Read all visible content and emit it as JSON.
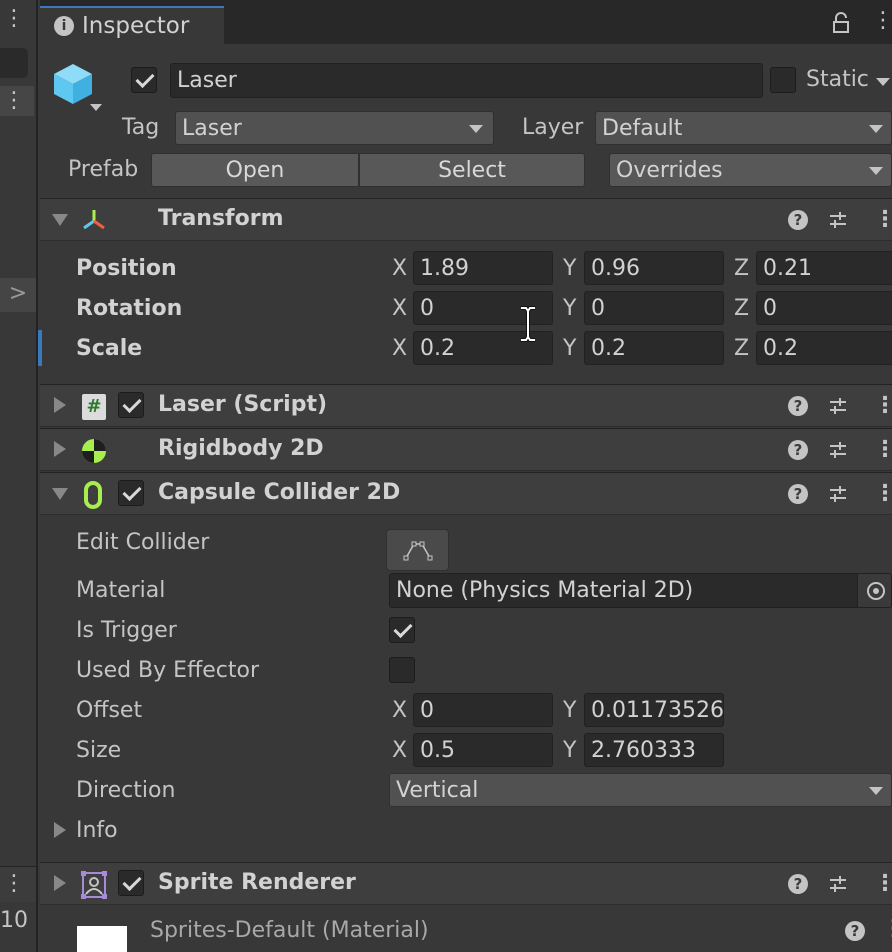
{
  "window": {
    "tab_label": "Inspector",
    "left_number": "10"
  },
  "gameobject": {
    "active": true,
    "name": "Laser",
    "static_label": "Static",
    "static_checked": false,
    "tag_label": "Tag",
    "tag_value": "Laser",
    "layer_label": "Layer",
    "layer_value": "Default",
    "prefab_label": "Prefab",
    "prefab_open": "Open",
    "prefab_select": "Select",
    "prefab_overrides": "Overrides"
  },
  "transform": {
    "title": "Transform",
    "rows": [
      {
        "label": "Position",
        "x": "1.89",
        "y": "0.96",
        "z": "0.21"
      },
      {
        "label": "Rotation",
        "x": "0",
        "y": "0",
        "z": "0"
      },
      {
        "label": "Scale",
        "x": "0.2",
        "y": "0.2",
        "z": "0.2"
      }
    ]
  },
  "axes": {
    "x": "X",
    "y": "Y",
    "z": "Z"
  },
  "laser_script": {
    "title": "Laser (Script)",
    "enabled": true
  },
  "rigidbody": {
    "title": "Rigidbody 2D"
  },
  "capsule": {
    "title": "Capsule Collider 2D",
    "enabled": true,
    "edit_collider_label": "Edit Collider",
    "material_label": "Material",
    "material_value": "None (Physics Material 2D)",
    "is_trigger_label": "Is Trigger",
    "is_trigger": true,
    "used_by_effector_label": "Used By Effector",
    "used_by_effector": false,
    "offset_label": "Offset",
    "offset_x": "0",
    "offset_y": "0.01173526",
    "size_label": "Size",
    "size_x": "0.5",
    "size_y": "2.760333",
    "direction_label": "Direction",
    "direction_value": "Vertical",
    "info_label": "Info"
  },
  "sprite_renderer": {
    "title": "Sprite Renderer",
    "enabled": true
  },
  "material_row": {
    "label": "Sprites-Default (Material)"
  },
  "colors": {
    "panel": "#383838",
    "header": "#3e3e3e",
    "field": "#2a2a2a",
    "accent": "#3a79bb",
    "cube": "#5ec8f0",
    "collider_green": "#a8ee50"
  }
}
